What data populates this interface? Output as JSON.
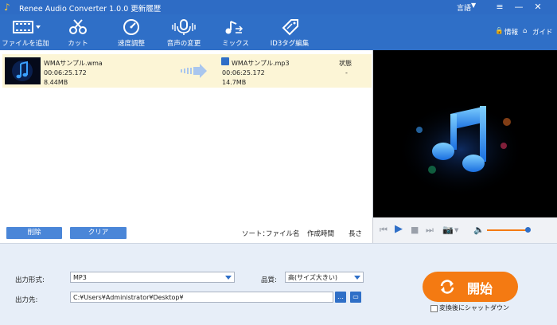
{
  "app": {
    "title": "Renee Audio Converter 1.0.0 更新履歴",
    "language": "言語"
  },
  "toolbar": {
    "items": [
      {
        "label": "ファイルを追加",
        "icon": "film-add-icon"
      },
      {
        "label": "カット",
        "icon": "scissors-icon"
      },
      {
        "label": "速度調整",
        "icon": "speedometer-icon"
      },
      {
        "label": "音声の変更",
        "icon": "microphone-icon"
      },
      {
        "label": "ミックス",
        "icon": "music-mix-icon"
      },
      {
        "label": "ID3タグ編集",
        "icon": "tag-edit-icon"
      }
    ],
    "info": "情報",
    "guide": "ガイド"
  },
  "file": {
    "input": {
      "name": "WMAサンプル.wma",
      "duration": "00:06:25.172",
      "size": "8.44MB"
    },
    "output": {
      "name": "WMAサンプル.mp3",
      "duration": "00:06:25.172",
      "size": "14.7MB"
    },
    "status_header": "状態",
    "status_value": "-"
  },
  "list_actions": {
    "delete": "削除",
    "clear": "クリア",
    "sort_label": "ソート：",
    "sort_name": "ファイル名",
    "sort_created": "作成時間",
    "sort_length": "長さ"
  },
  "player": {
    "volume": 0.9
  },
  "output": {
    "format_label": "出力形式:",
    "format_value": "MP3",
    "quality_label": "品質:",
    "quality_value": "高(サイズ大きい)",
    "dest_label": "出力先:",
    "dest_value": "C:¥Users¥Administrator¥Desktop¥",
    "browse": "…"
  },
  "start_button": "開始",
  "shutdown": "変換後にシャットダウン",
  "colors": {
    "accent": "#2f6fc7",
    "start": "#f47a12",
    "row_highlight": "#fcf5d6"
  }
}
